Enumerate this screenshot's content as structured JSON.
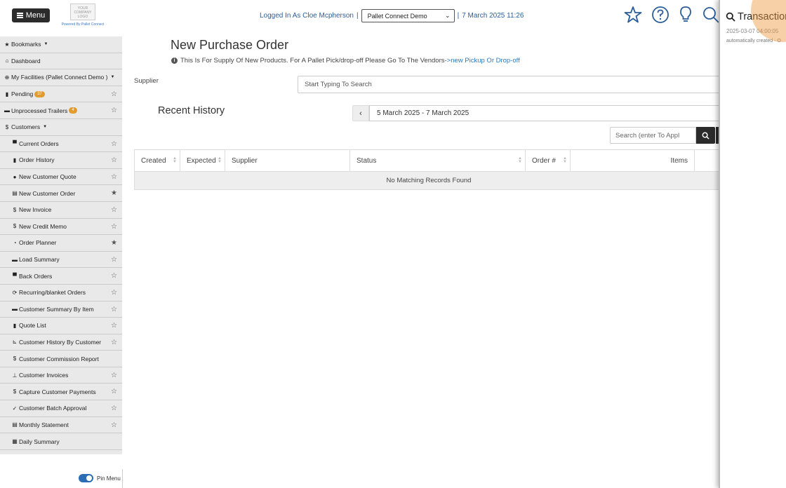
{
  "header": {
    "menu_label": "Menu",
    "logo_text": "YOUR COMPANY LOGO",
    "powered_by": "Powered By Pallet Connect",
    "logged_in_text": "Logged In As Cloe Mcpherson",
    "facility_select": "Pallet Connect Demo",
    "datetime": "7 March 2025 11:26",
    "separator": "|"
  },
  "sidebar": {
    "items": [
      {
        "icon": "★",
        "label": "Bookmarks",
        "caret": true,
        "sub": false,
        "star": "",
        "badge": ""
      },
      {
        "icon": "⌂",
        "label": "Dashboard",
        "caret": false,
        "sub": false,
        "star": "",
        "badge": ""
      },
      {
        "icon": "⊕",
        "label": "My Facilities (Pallet Connect Demo )",
        "caret": true,
        "sub": false,
        "star": "",
        "badge": ""
      },
      {
        "icon": "▮",
        "label": "Pending",
        "caret": false,
        "sub": false,
        "star": "☆",
        "badge": "37"
      },
      {
        "icon": "▬",
        "label": "Unprocessed Trailers",
        "caret": false,
        "sub": false,
        "star": "☆",
        "badge": "4"
      },
      {
        "icon": "$",
        "label": "Customers",
        "caret": true,
        "sub": false,
        "star": "",
        "badge": ""
      },
      {
        "icon": "▀",
        "label": "Current Orders",
        "caret": false,
        "sub": true,
        "star": "☆",
        "badge": ""
      },
      {
        "icon": "▮",
        "label": "Order History",
        "caret": false,
        "sub": true,
        "star": "☆",
        "badge": ""
      },
      {
        "icon": "●",
        "label": "New Customer Quote",
        "caret": false,
        "sub": true,
        "star": "☆",
        "badge": ""
      },
      {
        "icon": "▤",
        "label": "New Customer Order",
        "caret": false,
        "sub": true,
        "star": "★",
        "badge": ""
      },
      {
        "icon": "$",
        "label": "New Invoice",
        "caret": false,
        "sub": true,
        "star": "☆",
        "badge": ""
      },
      {
        "icon": "$",
        "label": "New Credit Memo",
        "caret": false,
        "sub": true,
        "star": "☆",
        "badge": ""
      },
      {
        "icon": "◔",
        "label": "Order Planner",
        "caret": false,
        "sub": true,
        "star": "★",
        "badge": ""
      },
      {
        "icon": "▬",
        "label": "Load Summary",
        "caret": false,
        "sub": true,
        "star": "☆",
        "badge": ""
      },
      {
        "icon": "▀",
        "label": "Back Orders",
        "caret": false,
        "sub": true,
        "star": "☆",
        "badge": ""
      },
      {
        "icon": "⟳",
        "label": "Recurring/blanket Orders",
        "caret": false,
        "sub": true,
        "star": "☆",
        "badge": ""
      },
      {
        "icon": "▬",
        "label": "Customer Summary By Item",
        "caret": false,
        "sub": true,
        "star": "☆",
        "badge": ""
      },
      {
        "icon": "▮",
        "label": "Quote List",
        "caret": false,
        "sub": true,
        "star": "☆",
        "badge": ""
      },
      {
        "icon": "⊾",
        "label": "Customer History By Customer",
        "caret": false,
        "sub": true,
        "star": "☆",
        "badge": ""
      },
      {
        "icon": "$",
        "label": "Customer Commission Report",
        "caret": false,
        "sub": true,
        "star": "",
        "badge": ""
      },
      {
        "icon": "⊥",
        "label": "Customer Invoices",
        "caret": false,
        "sub": true,
        "star": "☆",
        "badge": ""
      },
      {
        "icon": "$",
        "label": "Capture Customer Payments",
        "caret": false,
        "sub": true,
        "star": "☆",
        "badge": ""
      },
      {
        "icon": "✓",
        "label": "Customer Batch Approval",
        "caret": false,
        "sub": true,
        "star": "☆",
        "badge": ""
      },
      {
        "icon": "▤",
        "label": "Monthly Statement",
        "caret": false,
        "sub": true,
        "star": "☆",
        "badge": ""
      },
      {
        "icon": "▦",
        "label": "Daily Summary",
        "caret": false,
        "sub": true,
        "star": "",
        "badge": ""
      },
      {
        "icon": "▬",
        "label": "",
        "caret": false,
        "sub": true,
        "star": "★",
        "badge": ""
      }
    ],
    "pin_label": "Pin Menu"
  },
  "main": {
    "title": "New Purchase Order",
    "info_text": "This Is For Supply Of New Products. For A Pallet Pick/drop-off Please Go To The Vendors-",
    "info_link": ">new Pickup Or Drop-off",
    "supplier_label": "Supplier",
    "supplier_placeholder": "Start Typing To Search",
    "recent_title": "Recent History",
    "date_range": "5 March 2025 - 7 March 2025",
    "search_placeholder": "Search (enter To Appl",
    "table": {
      "columns": [
        "Created",
        "Expected",
        "Supplier",
        "Status",
        "Order #",
        "Items"
      ],
      "empty_message": "No Matching Records Found"
    }
  },
  "transaction_panel": {
    "title": "Transaction",
    "timestamp": "2025-03-07 04:00:05",
    "note": "automatically created - O"
  },
  "colors": {
    "accent": "#2a7bc0",
    "dark_button": "#2b2b2b",
    "badge": "#e09c2e",
    "sidebar_bg": "#e9e9e9",
    "highlight": "#f0963c"
  },
  "icons": [
    "hamburger-icon",
    "star-icon",
    "help-icon",
    "lightbulb-icon",
    "search-icon",
    "info-icon",
    "chevron-left-icon"
  ]
}
